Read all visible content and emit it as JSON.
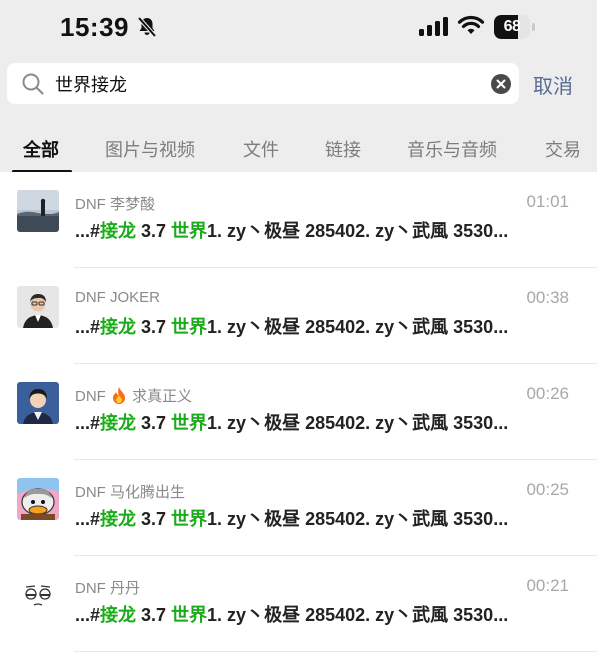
{
  "status_bar": {
    "time": "15:39",
    "battery_percent": "68",
    "battery_level": 0.68,
    "icons": [
      "bell-slash-icon",
      "cellular-signal-icon",
      "wifi-icon",
      "battery-icon"
    ]
  },
  "search": {
    "query": "世界接龙",
    "cancel_label": "取消"
  },
  "tabs": [
    "全部",
    "图片与视频",
    "文件",
    "链接",
    "音乐与音频",
    "交易"
  ],
  "active_tab": "全部",
  "colors": {
    "highlight": "#1aad19",
    "link_blue": "#576b95",
    "background": "#ededed"
  },
  "snippet_parts": {
    "prefix": "...#",
    "kw1": "接龙",
    "mid": " 3.7 ",
    "kw2": "世界",
    "suffix": "1. zy丶极昼 285402. zy丶武風 3530..."
  },
  "results": [
    {
      "sender_prefix": "DNF",
      "sender_name": "李梦酸",
      "time": "01:01",
      "emoji": "",
      "avatar": "avatar-landscape-photo"
    },
    {
      "sender_prefix": "DNF",
      "sender_name": "JOKER",
      "time": "00:38",
      "emoji": "",
      "avatar": "avatar-man-suit-photo"
    },
    {
      "sender_prefix": "DNF",
      "sender_name": "求真正义",
      "time": "00:26",
      "emoji": "fire-emoji-icon",
      "avatar": "avatar-young-man-photo"
    },
    {
      "sender_prefix": "DNF",
      "sender_name": "马化腾出生",
      "time": "00:25",
      "emoji": "",
      "avatar": "avatar-cartoon-duck"
    },
    {
      "sender_prefix": "DNF",
      "sender_name": "丹丹",
      "time": "00:21",
      "emoji": "",
      "avatar": "avatar-emoji-face"
    }
  ]
}
